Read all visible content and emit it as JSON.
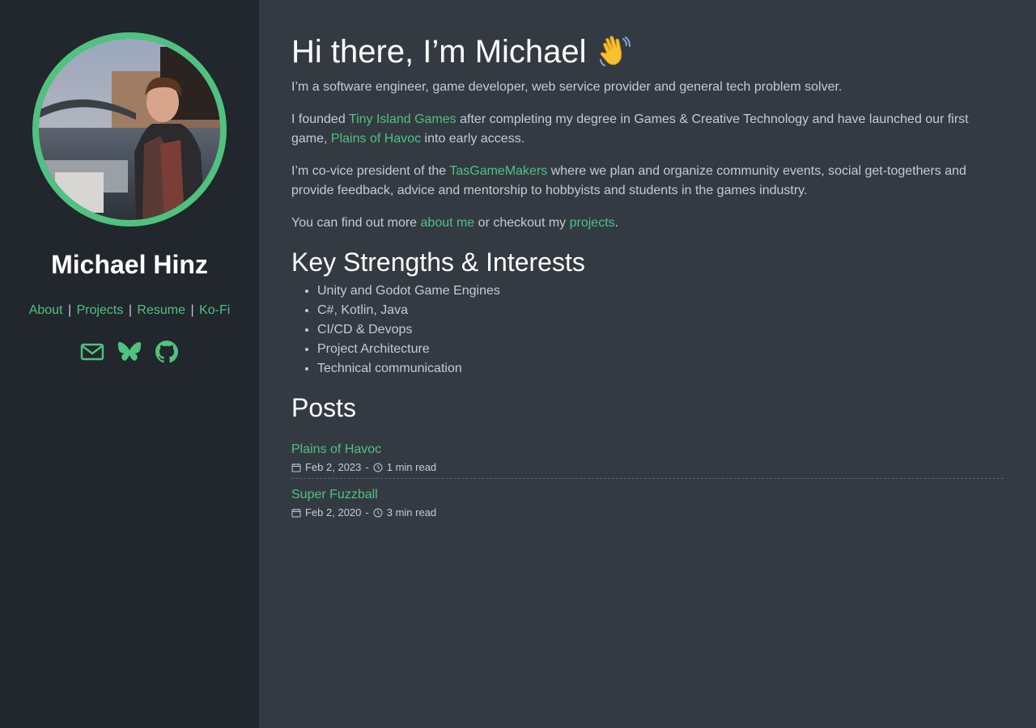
{
  "sidebar": {
    "name": "Michael Hinz",
    "nav": [
      {
        "label": "About"
      },
      {
        "label": "Projects"
      },
      {
        "label": "Resume"
      },
      {
        "label": "Ko-Fi"
      }
    ],
    "nav_separator": "|",
    "social_icons": [
      "mail-icon",
      "butterfly-icon",
      "github-icon"
    ]
  },
  "main": {
    "title": "Hi there, I’m Michael",
    "title_emoji": "waving-hand",
    "intro": {
      "p1": "I’m a software engineer, game developer, web service provider and general tech problem solver.",
      "p2_a": "I founded ",
      "p2_link1": "Tiny Island Games",
      "p2_b": " after completing my degree in Games & Creative Technology and have launched our first game, ",
      "p2_link2": "Plains of Havoc",
      "p2_c": " into early access.",
      "p3_a": "I’m co-vice president of the ",
      "p3_link": "TasGameMakers",
      "p3_b": " where we plan and organize community events, social get-togethers and provide feedback, advice and mentorship to hobbyists and students in the games industry.",
      "p4_a": "You can find out more ",
      "p4_link1": "about me",
      "p4_b": " or checkout my ",
      "p4_link2": "projects",
      "p4_c": "."
    },
    "strengths_title": "Key Strengths & Interests",
    "strengths": [
      "Unity and Godot Game Engines",
      "C#, Kotlin, Java",
      "CI/CD & Devops",
      "Project Architecture",
      "Technical communication"
    ],
    "posts_title": "Posts",
    "posts": [
      {
        "title": "Plains of Havoc",
        "date": "Feb 2, 2023",
        "sep": "-",
        "read": "1 min read"
      },
      {
        "title": "Super Fuzzball",
        "date": "Feb 2, 2020",
        "sep": "-",
        "read": "3 min read"
      }
    ]
  },
  "colors": {
    "accent": "#4fc27f",
    "sidebar_bg": "#22262d",
    "main_bg": "#343a42",
    "text": "#c6cbd1",
    "heading": "#ffffff"
  }
}
